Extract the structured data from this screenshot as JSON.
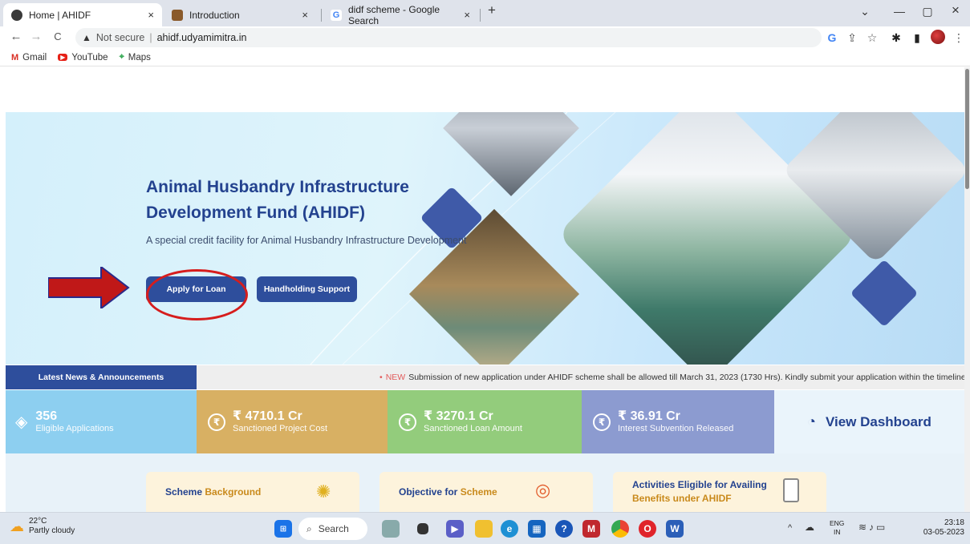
{
  "browser": {
    "tabs": [
      {
        "title": "Home | AHIDF",
        "close": "×"
      },
      {
        "title": "Introduction",
        "close": "×"
      },
      {
        "title": "didf scheme - Google Search",
        "close": "×"
      }
    ],
    "new_tab": "+",
    "window_controls": {
      "dropdown": "⌄",
      "minimize": "—",
      "maximize": "▢",
      "close": "×"
    },
    "nav": {
      "back": "←",
      "forward": "→",
      "reload": "C"
    },
    "url": {
      "security": "Not secure",
      "address": "ahidf.udyamimitra.in"
    },
    "toolbar_icons": {
      "google": "G",
      "share": "⇪",
      "star": "☆",
      "extensions": "✱",
      "sidepanel": "▮",
      "menu": "⋮"
    },
    "bookmarks": [
      {
        "label": "Gmail",
        "icon": "M"
      },
      {
        "label": "YouTube",
        "icon": "▶"
      },
      {
        "label": "Maps",
        "icon": "⌖"
      }
    ]
  },
  "hero": {
    "title_line1": "Animal Husbandry Infrastructure",
    "title_line2": "Development Fund (AHIDF)",
    "subtitle": "A special credit facility for Animal Husbandry Infrastructure Development",
    "apply_label": "Apply for Loan",
    "handholding_label": "Handholding Support"
  },
  "news": {
    "label": "Latest News & Announcements",
    "prefix": "NEW",
    "text": "Submission of new application under AHIDF scheme shall be allowed till March 31, 2023 (1730 Hrs). Kindly submit your application within the timeline. | Ple"
  },
  "stats": [
    {
      "value": "356",
      "label": "Eligible Applications",
      "color": "#8dcff0"
    },
    {
      "value": "₹ 4710.1 Cr",
      "label": "Sanctioned Project Cost",
      "color": "#d8b063"
    },
    {
      "value": "₹ 3270.1 Cr",
      "label": "Sanctioned Loan Amount",
      "color": "#93cc7c"
    },
    {
      "value": "₹ 36.91 Cr",
      "label": "Interest Subvention Released",
      "color": "#8c9bd0"
    }
  ],
  "view_dashboard": "View Dashboard",
  "cards": [
    {
      "title_a": "Scheme",
      "title_b": "Background"
    },
    {
      "title_a": "Objective for",
      "title_b": "Scheme"
    },
    {
      "title_a": "Activities Eligible for Availing",
      "title_b": "Benefits under AHIDF"
    }
  ],
  "taskbar": {
    "weather_temp": "22°C",
    "weather_desc": "Partly cloudy",
    "search": "Search",
    "lang": "ENG",
    "region": "IN",
    "time": "23:18",
    "date": "03-05-2023"
  },
  "colors": {
    "primary": "#2e4e9c",
    "annotation": "#d61d1d"
  }
}
